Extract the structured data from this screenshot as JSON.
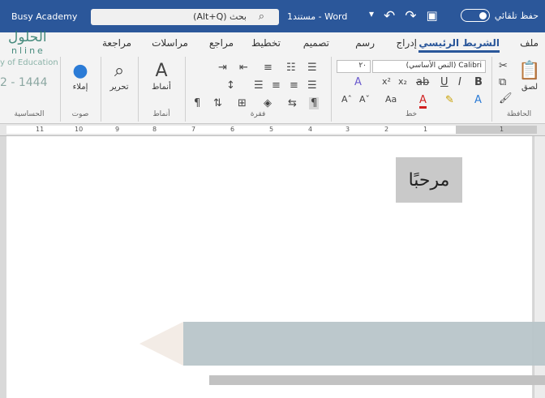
{
  "titlebar": {
    "autosave_label": "حفظ تلقائي",
    "doc_label": "Word  -  مستند1",
    "search_text": "بحث (Alt+Q)",
    "account_text": "Busy Academy"
  },
  "tabs": [
    "ملف",
    "الشريط الرئيسي",
    "إدراج",
    "رسم",
    "تصميم",
    "تخطيط",
    "مراجع",
    "مراسلات",
    "مراجعة"
  ],
  "active_tab": "الشريط الرئيسي",
  "ribbon": {
    "clipboard": {
      "paste_label": "لصق",
      "group_label": "الحافظة"
    },
    "font": {
      "font_name": "Calibri (النص الأساسي)",
      "font_size": "٢٠",
      "group_label": "خط"
    },
    "paragraph": {
      "group_label": "فقرة"
    },
    "styles": {
      "styles_label": "أنماط",
      "group_label": "أنماط"
    },
    "editing": {
      "editing_label": "تحرير"
    },
    "voice": {
      "dictate_label": "إملاء",
      "group_label": "صوت"
    },
    "sensitivity": {
      "group_label": "الحساسية"
    }
  },
  "ruler": {
    "ticks": [
      "11",
      "10",
      "9",
      "8",
      "7",
      "6",
      "5",
      "4",
      "3",
      "2",
      "1",
      "1"
    ]
  },
  "document": {
    "text": "مرحبًا"
  },
  "watermark": {
    "logo_text": "الحلول",
    "year_text": "2 - 1444",
    "online_text": "nline",
    "edu_text": "y of Education"
  }
}
